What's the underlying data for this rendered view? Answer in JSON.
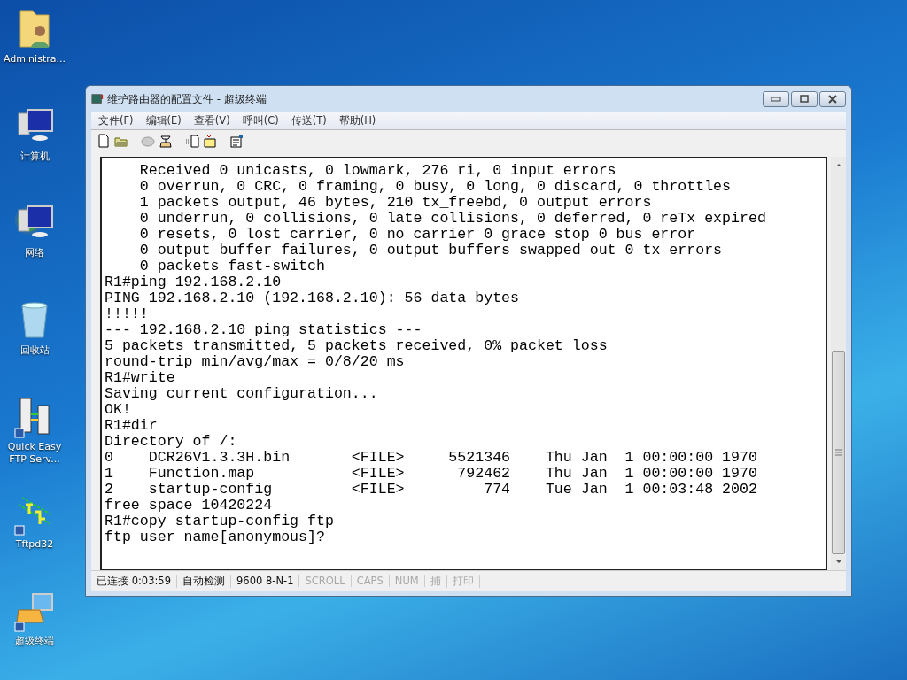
{
  "desktop": {
    "icons": [
      {
        "label": "Administra...",
        "kind": "user-folder"
      },
      {
        "label": "计算机",
        "kind": "computer"
      },
      {
        "label": "网络",
        "kind": "network"
      },
      {
        "label": "回收站",
        "kind": "recycle"
      },
      {
        "label": "Quick Easy FTP Serv...",
        "kind": "ftp"
      },
      {
        "label": "Tftpd32",
        "kind": "tftp"
      },
      {
        "label": "超级终端",
        "kind": "terminal"
      }
    ]
  },
  "window": {
    "title": "维护路由器的配置文件 - 超级终端",
    "menu": [
      "文件(F)",
      "编辑(E)",
      "查看(V)",
      "呼叫(C)",
      "传送(T)",
      "帮助(H)"
    ],
    "terminal": {
      "lines": [
        "    Received 0 unicasts, 0 lowmark, 276 ri, 0 input errors",
        "    0 overrun, 0 CRC, 0 framing, 0 busy, 0 long, 0 discard, 0 throttles",
        "    1 packets output, 46 bytes, 210 tx_freebd, 0 output errors",
        "    0 underrun, 0 collisions, 0 late collisions, 0 deferred, 0 reTx expired",
        "    0 resets, 0 lost carrier, 0 no carrier 0 grace stop 0 bus error",
        "    0 output buffer failures, 0 output buffers swapped out 0 tx errors",
        "    0 packets fast-switch",
        "R1#ping 192.168.2.10",
        "PING 192.168.2.10 (192.168.2.10): 56 data bytes",
        "!!!!!",
        "--- 192.168.2.10 ping statistics ---",
        "5 packets transmitted, 5 packets received, 0% packet loss",
        "round-trip min/avg/max = 0/8/20 ms",
        "R1#write",
        "Saving current configuration...",
        "OK!",
        "R1#dir",
        "Directory of /:",
        "0    DCR26V1.3.3H.bin       <FILE>     5521346    Thu Jan  1 00:00:00 1970",
        "1    Function.map           <FILE>      792462    Thu Jan  1 00:00:00 1970",
        "2    startup-config         <FILE>         774    Tue Jan  1 00:03:48 2002",
        "free space 10420224",
        "R1#copy startup-config ftp",
        "ftp user name[anonymous]?"
      ]
    },
    "status_bar": [
      {
        "text": "已连接 0:03:59",
        "on": true
      },
      {
        "text": "自动检测",
        "on": true
      },
      {
        "text": "9600 8-N-1",
        "on": true
      },
      {
        "text": "SCROLL",
        "on": false
      },
      {
        "text": "CAPS",
        "on": false
      },
      {
        "text": "NUM",
        "on": false
      },
      {
        "text": "捕",
        "on": false
      },
      {
        "text": "打印",
        "on": false
      }
    ]
  }
}
